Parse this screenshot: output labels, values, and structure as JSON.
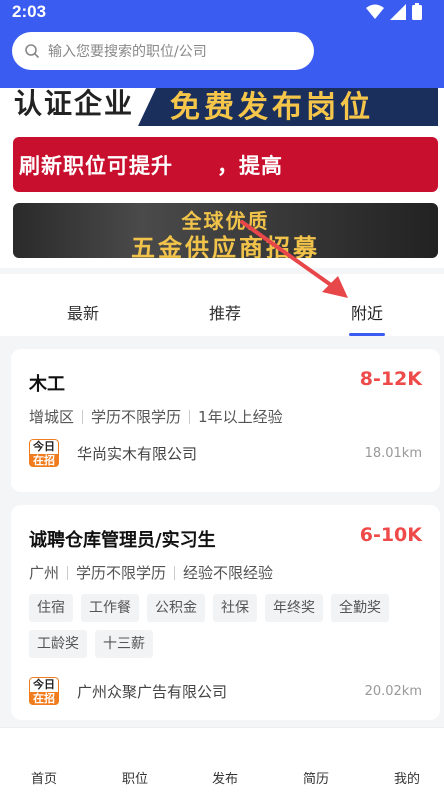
{
  "status_bar": {
    "time": "2:03"
  },
  "search": {
    "placeholder": "输入您要搜索的职位/公司"
  },
  "banners": {
    "b1_left": "认证企业",
    "b1_right": "免费发布岗位",
    "b2": "刷新职位可提升　　，提高",
    "b3_line1": "全球优质",
    "b3_line2": "五金供应商招募"
  },
  "tabs": [
    {
      "label": "最新"
    },
    {
      "label": "推荐"
    },
    {
      "label": "附近"
    }
  ],
  "active_tab": "附近",
  "jobs": [
    {
      "title": "木工",
      "salary": "8-12K",
      "meta": [
        "增城区",
        "学历不限学历",
        "1年以上经验"
      ],
      "badge_top": "今日",
      "badge_bottom": "在招",
      "company": "华尚实木有限公司",
      "distance": "18.01km"
    },
    {
      "title": "诚聘仓库管理员/实习生",
      "salary": "6-10K",
      "meta": [
        "广州",
        "学历不限学历",
        "经验不限经验"
      ],
      "tags": [
        "住宿",
        "工作餐",
        "公积金",
        "社保",
        "年终奖",
        "全勤奖",
        "工龄奖",
        "十三薪"
      ],
      "badge_top": "今日",
      "badge_bottom": "在招",
      "company": "广州众聚广告有限公司",
      "distance": "20.02km"
    }
  ],
  "bottom_nav": [
    {
      "label": "首页"
    },
    {
      "label": "职位"
    },
    {
      "label": "发布"
    },
    {
      "label": "简历"
    },
    {
      "label": "我的"
    }
  ],
  "colors": {
    "header": "#3b5cf0",
    "salary": "#ef4a4a",
    "badge": "#f07c1e",
    "annotation_arrow": "#e8474a"
  }
}
